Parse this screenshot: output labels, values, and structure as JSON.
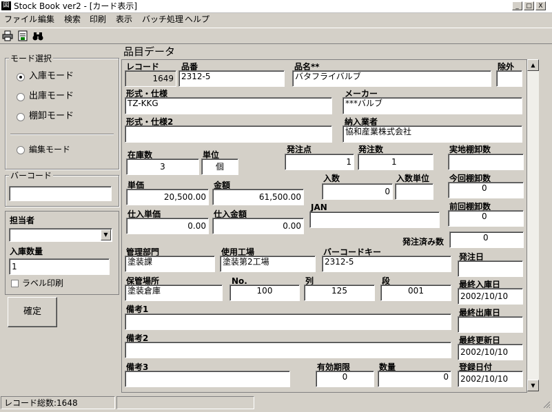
{
  "window": {
    "title": "Stock Book ver2 - [カード表示]",
    "app_icon": "図",
    "min": "_",
    "max": "□",
    "close": "X"
  },
  "menu": [
    "ファイル",
    "編集",
    "検索",
    "印刷",
    "表示",
    "バッチ処理",
    "ヘルプ"
  ],
  "toolbar_icons": [
    "printer-icon",
    "preview-icon",
    "binoculars-icon"
  ],
  "section_title": "品目データ",
  "left": {
    "mode_group": "モード選択",
    "modes": [
      "入庫モード",
      "出庫モード",
      "棚卸モード"
    ],
    "edit_mode": "編集モード",
    "barcode_group": "バーコード",
    "barcode_value": "",
    "person_label": "担当者",
    "person_value": "",
    "qty_label": "入庫数量",
    "qty_value": "1",
    "label_print": "ラベル印刷",
    "confirm": "確定"
  },
  "fields": {
    "record": {
      "label": "レコード",
      "value": "1649"
    },
    "part_no": {
      "label": "品番",
      "value": "2312-5"
    },
    "part_name": {
      "label": "品名**",
      "value": "バタフライバルブ"
    },
    "exclude": {
      "label": "除外",
      "value": ""
    },
    "model": {
      "label": "形式・仕様",
      "value": "TZ-KKG"
    },
    "maker": {
      "label": "メーカー",
      "value": "***バルブ"
    },
    "model2": {
      "label": "形式・仕様2",
      "value": ""
    },
    "supplier": {
      "label": "納入業者",
      "value": "協和産業株式会社"
    },
    "stock": {
      "label": "在庫数",
      "value": "3"
    },
    "unit": {
      "label": "単位",
      "value": "個"
    },
    "order_point": {
      "label": "発注点",
      "value": "1"
    },
    "order_qty": {
      "label": "発注数",
      "value": "1"
    },
    "actual_inv": {
      "label": "実地棚卸数",
      "value": ""
    },
    "unit_price": {
      "label": "単価",
      "value": "20,500.00"
    },
    "amount": {
      "label": "金額",
      "value": "61,500.00"
    },
    "in_count": {
      "label": "入数",
      "value": "0"
    },
    "in_unit": {
      "label": "入数単位",
      "value": ""
    },
    "this_inv": {
      "label": "今回棚卸数",
      "value": "0"
    },
    "purchase_price": {
      "label": "仕入単価",
      "value": "0.00"
    },
    "purchase_amount": {
      "label": "仕入金額",
      "value": "0.00"
    },
    "jan": {
      "label": "JAN",
      "value": ""
    },
    "prev_inv": {
      "label": "前回棚卸数",
      "value": "0"
    },
    "ordered": {
      "label": "発注済み数",
      "value": "0"
    },
    "dept": {
      "label": "管理部門",
      "value": "塗装課"
    },
    "factory": {
      "label": "使用工場",
      "value": "塗装第2工場"
    },
    "barcode_key": {
      "label": "バーコードキー",
      "value": "2312-5"
    },
    "order_date": {
      "label": "発注日",
      "value": ""
    },
    "location": {
      "label": "保管場所",
      "value": "塗装倉庫"
    },
    "no": {
      "label": "No.",
      "value": "100"
    },
    "col": {
      "label": "列",
      "value": "125"
    },
    "tier": {
      "label": "段",
      "value": "001"
    },
    "last_in": {
      "label": "最終入庫日",
      "value": "2002/10/10"
    },
    "note1": {
      "label": "備考1",
      "value": ""
    },
    "last_out": {
      "label": "最終出庫日",
      "value": ""
    },
    "note2": {
      "label": "備考2",
      "value": ""
    },
    "last_update": {
      "label": "最終更新日",
      "value": "2002/10/10"
    },
    "note3": {
      "label": "備考3",
      "value": ""
    },
    "expiry": {
      "label": "有効期限",
      "value": "0"
    },
    "quantity": {
      "label": "数量",
      "value": "0"
    },
    "reg_date": {
      "label": "登録日付",
      "value": "2002/10/10"
    }
  },
  "status": {
    "total_records": "レコード総数:1648"
  }
}
